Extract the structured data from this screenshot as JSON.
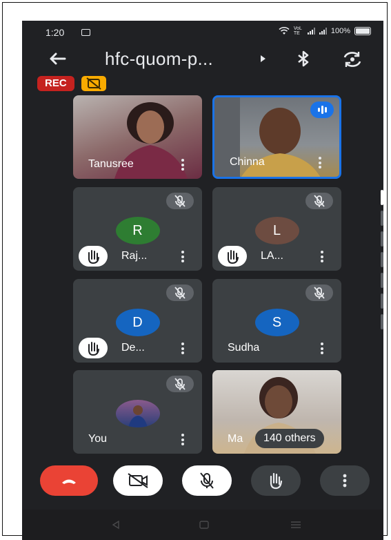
{
  "status_bar": {
    "time": "1:20",
    "network_label": "VoLTE",
    "battery": "100%"
  },
  "header": {
    "meeting_title": "hfc-quom-p..."
  },
  "badges": {
    "rec_label": "REC"
  },
  "participants": [
    {
      "name": "Tanusree",
      "type": "video",
      "speaking": false
    },
    {
      "name": "Chinna",
      "type": "video",
      "speaking": true
    },
    {
      "name": "Raj...",
      "initial": "R",
      "avatar_color": "#2e7d32",
      "hand_raised": true,
      "muted": true
    },
    {
      "name": "LA...",
      "initial": "L",
      "avatar_color": "#6d4c41",
      "hand_raised": true,
      "muted": true
    },
    {
      "name": "De...",
      "initial": "D",
      "avatar_color": "#1565c0",
      "hand_raised": true,
      "muted": true
    },
    {
      "name": "Sudha",
      "initial": "S",
      "avatar_color": "#1565c0",
      "hand_raised": false,
      "muted": true
    },
    {
      "name": "You",
      "type": "photo-avatar",
      "muted": true
    },
    {
      "name": "Ma",
      "type": "video",
      "others_label": "140 others"
    }
  ],
  "colors": {
    "background": "#202124",
    "tile": "#3c4043",
    "rec": "#c5221f",
    "speaking": "#1a73e8",
    "end_call": "#ea4335"
  },
  "icons": {
    "back": "arrow-left-icon",
    "bluetooth": "bluetooth-icon",
    "flip": "switch-camera-icon",
    "camera_off": "camera-off-icon",
    "mic_off": "mic-off-icon",
    "hand": "raise-hand-icon",
    "more": "more-vert-icon",
    "end": "phone-hangup-icon"
  }
}
